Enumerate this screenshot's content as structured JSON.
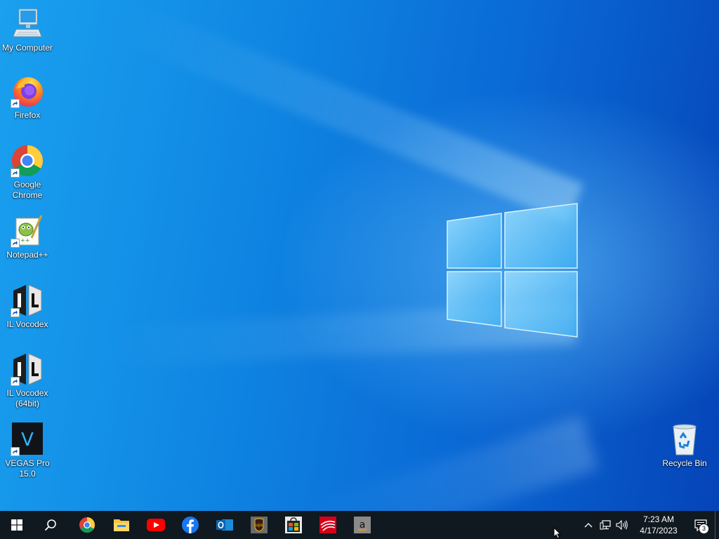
{
  "desktop": {
    "icons": [
      {
        "label": "My Computer",
        "icon": "computer-icon"
      },
      {
        "label": "Firefox",
        "icon": "firefox-icon"
      },
      {
        "label": "Google Chrome",
        "icon": "chrome-icon"
      },
      {
        "label": "Notepad++",
        "icon": "notepadpp-icon"
      },
      {
        "label": "IL Vocodex",
        "icon": "il-vocodex-icon"
      },
      {
        "label": "IL Vocodex (64bit)",
        "icon": "il-vocodex-icon"
      },
      {
        "label": "VEGAS Pro 15.0",
        "icon": "vegas-pro-icon"
      },
      {
        "label": "Recycle Bin",
        "icon": "recycle-bin-icon"
      }
    ]
  },
  "taskbar": {
    "start": "windows-start-icon",
    "search": "search-icon",
    "apps": [
      {
        "icon": "chrome-icon"
      },
      {
        "icon": "file-explorer-icon"
      },
      {
        "icon": "youtube-icon"
      },
      {
        "icon": "facebook-icon"
      },
      {
        "icon": "outlook-icon"
      },
      {
        "icon": "ups-icon"
      },
      {
        "icon": "store-icon"
      },
      {
        "icon": "bank-of-america-icon"
      },
      {
        "icon": "amazon-icon"
      }
    ],
    "tray": {
      "time": "7:23 AM",
      "date": "4/17/2023",
      "notification_count": "3"
    }
  },
  "colors": {
    "taskbar": "#101820",
    "wallpaper_main": "#0f86e2",
    "wallpaper_dark": "#0544b8"
  }
}
